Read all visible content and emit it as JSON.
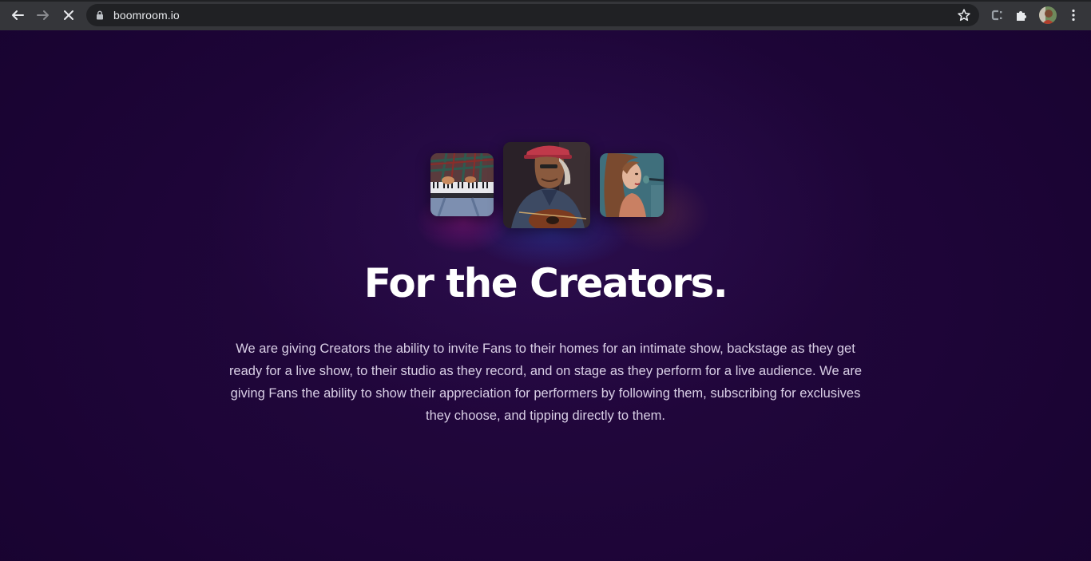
{
  "browser": {
    "url": "boomroom.io",
    "icons": [
      "back-arrow-icon",
      "forward-arrow-icon",
      "stop-loading-icon",
      "lock-icon",
      "bookmark-star-icon",
      "extension-c-icon",
      "puzzle-extensions-icon",
      "profile-avatar",
      "more-menu-icon"
    ]
  },
  "hero": {
    "images": [
      "keyboard-player-photo",
      "guitar-player-photo",
      "singer-photo"
    ],
    "title": "For the Creators.",
    "description": "We are giving Creators the ability to invite Fans to their homes for an intimate show, backstage as they get ready for a live show, to their studio as they record, and on stage as they perform for a live audience. We are giving Fans the ability to show their appreciation for performers by following them, subscribing for exclusives they choose, and tipping directly to them."
  },
  "colors": {
    "background": "#1c0638",
    "title": "#ffffff",
    "body": "#d9cfe6",
    "chrome": "#35363a",
    "omnibox": "#202124"
  }
}
